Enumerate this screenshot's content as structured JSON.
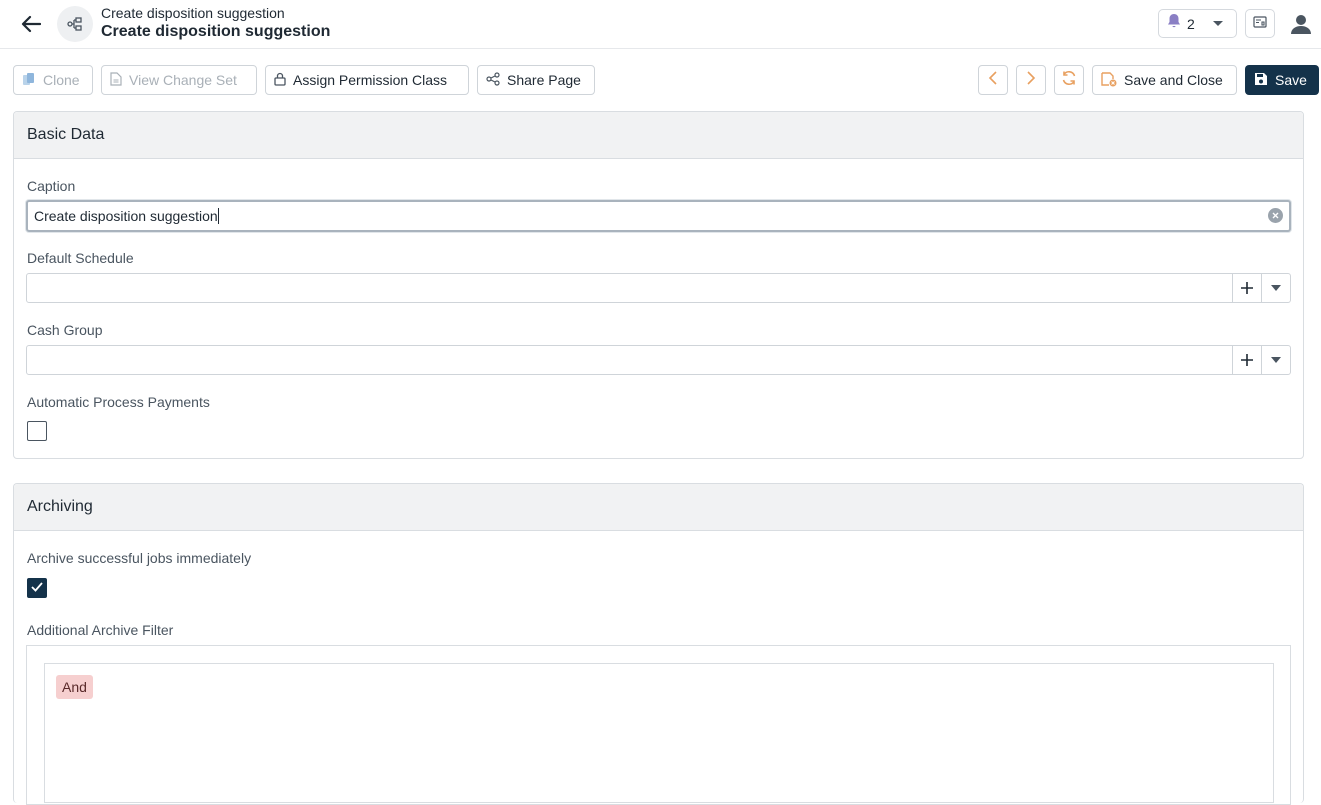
{
  "header": {
    "subtitle": "Create disposition suggestion",
    "title": "Create disposition suggestion",
    "notification_count": "2"
  },
  "toolbar": {
    "clone_label": "Clone",
    "view_change_set_label": "View Change Set",
    "assign_permission_class_label": "Assign Permission Class",
    "share_page_label": "Share Page",
    "save_and_close_label": "Save and Close",
    "save_label": "Save"
  },
  "basic_data": {
    "heading": "Basic Data",
    "caption_label": "Caption",
    "caption_value": "Create disposition suggestion",
    "default_schedule_label": "Default Schedule",
    "default_schedule_value": "",
    "cash_group_label": "Cash Group",
    "cash_group_value": "",
    "automatic_process_payments_label": "Automatic Process Payments",
    "automatic_process_payments_checked": false
  },
  "archiving": {
    "heading": "Archiving",
    "archive_immediately_label": "Archive successful jobs immediately",
    "archive_immediately_checked": true,
    "additional_filter_label": "Additional Archive Filter",
    "filter_operator": "And"
  },
  "colors": {
    "primary": "#14324a",
    "accent_orange": "#e8a060",
    "and_chip_bg": "#f6cfcf",
    "bell": "#8a7fc4"
  },
  "icons": [
    "back-arrow-icon",
    "workflow-icon",
    "bell-icon",
    "chevron-down-icon",
    "id-card-icon",
    "user-icon",
    "copy-icon",
    "document-icon",
    "lock-icon",
    "share-icon",
    "chevron-left-icon",
    "chevron-right-icon",
    "refresh-icon",
    "save-close-icon",
    "save-icon",
    "clear-icon",
    "plus-icon",
    "checkmark-icon"
  ]
}
